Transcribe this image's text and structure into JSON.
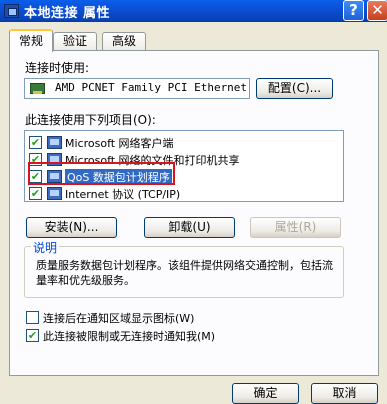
{
  "window": {
    "title": "本地连接 属性",
    "help_glyph": "?",
    "close_glyph": "✕"
  },
  "tabs": [
    {
      "label": "常规",
      "active": true
    },
    {
      "label": "验证",
      "active": false
    },
    {
      "label": "高级",
      "active": false
    }
  ],
  "connect_using": {
    "label": "连接时使用:",
    "device": "AMD PCNET Family PCI Ethernet",
    "configure_button": "配置(C)..."
  },
  "components": {
    "label": "此连接使用下列项目(O):",
    "items": [
      {
        "label": "Microsoft 网络客户端",
        "checked": true,
        "selected": false
      },
      {
        "label": "Microsoft 网络的文件和打印机共享",
        "checked": true,
        "selected": false
      },
      {
        "label": "QoS 数据包计划程序",
        "checked": true,
        "selected": true
      },
      {
        "label": "Internet 协议 (TCP/IP)",
        "checked": true,
        "selected": false
      }
    ],
    "check_glyph": "✔"
  },
  "actions": {
    "install": "安装(N)...",
    "uninstall": "卸载(U)",
    "properties": "属性(R)"
  },
  "description": {
    "title": "说明",
    "text": "质量服务数据包计划程序。该组件提供网络交通控制，包括流量率和优先级服务。"
  },
  "options": [
    {
      "label": "连接后在通知区域显示图标(W)",
      "checked": false
    },
    {
      "label": "此连接被限制或无连接时通知我(M)",
      "checked": true
    }
  ],
  "footer": {
    "ok": "确定",
    "cancel": "取消"
  },
  "colors": {
    "titlebar": "#0b50d6",
    "selection": "#316ac5",
    "highlight_box": "#d8141c",
    "group_title": "#0046d5"
  }
}
